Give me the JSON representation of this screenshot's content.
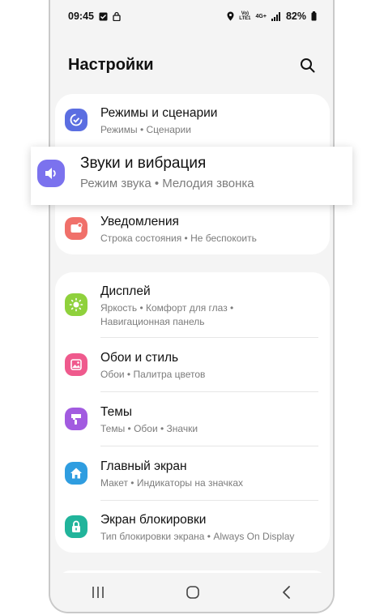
{
  "status_bar": {
    "time": "09:45",
    "battery": "82%",
    "network_top": "Vo)",
    "network_bottom": "LTE1",
    "network_type": "4G+"
  },
  "header": {
    "title": "Настройки"
  },
  "card1": {
    "items": [
      {
        "title": "Режимы и сценарии",
        "subtitle": "Режимы • Сценарии",
        "icon": "modes-icon",
        "color": "#5b6ee1"
      },
      {
        "title": "Уведомления",
        "subtitle": "Строка состояния • Не беспокоить",
        "icon": "notifications-icon",
        "color": "#f0706a"
      }
    ]
  },
  "highlight": {
    "title": "Звуки и вибрация",
    "subtitle": "Режим звука • Мелодия звонка",
    "icon": "sound-icon",
    "color": "#7b72ee"
  },
  "card2": {
    "items": [
      {
        "title": "Дисплей",
        "subtitle": "Яркость • Комфорт для глаз • Навигационная панель",
        "icon": "sun-icon",
        "color": "#8fd13c"
      },
      {
        "title": "Обои и стиль",
        "subtitle": "Обои • Палитра цветов",
        "icon": "wallpaper-icon",
        "color": "#ef5a8d"
      },
      {
        "title": "Темы",
        "subtitle": "Темы • Обои • Значки",
        "icon": "themes-icon",
        "color": "#a25be0"
      },
      {
        "title": "Главный экран",
        "subtitle": "Макет • Индикаторы на значках",
        "icon": "home-icon",
        "color": "#2f9de0"
      },
      {
        "title": "Экран блокировки",
        "subtitle": "Тип блокировки экрана • Always On Display",
        "icon": "lock-icon",
        "color": "#21b49b"
      }
    ]
  }
}
